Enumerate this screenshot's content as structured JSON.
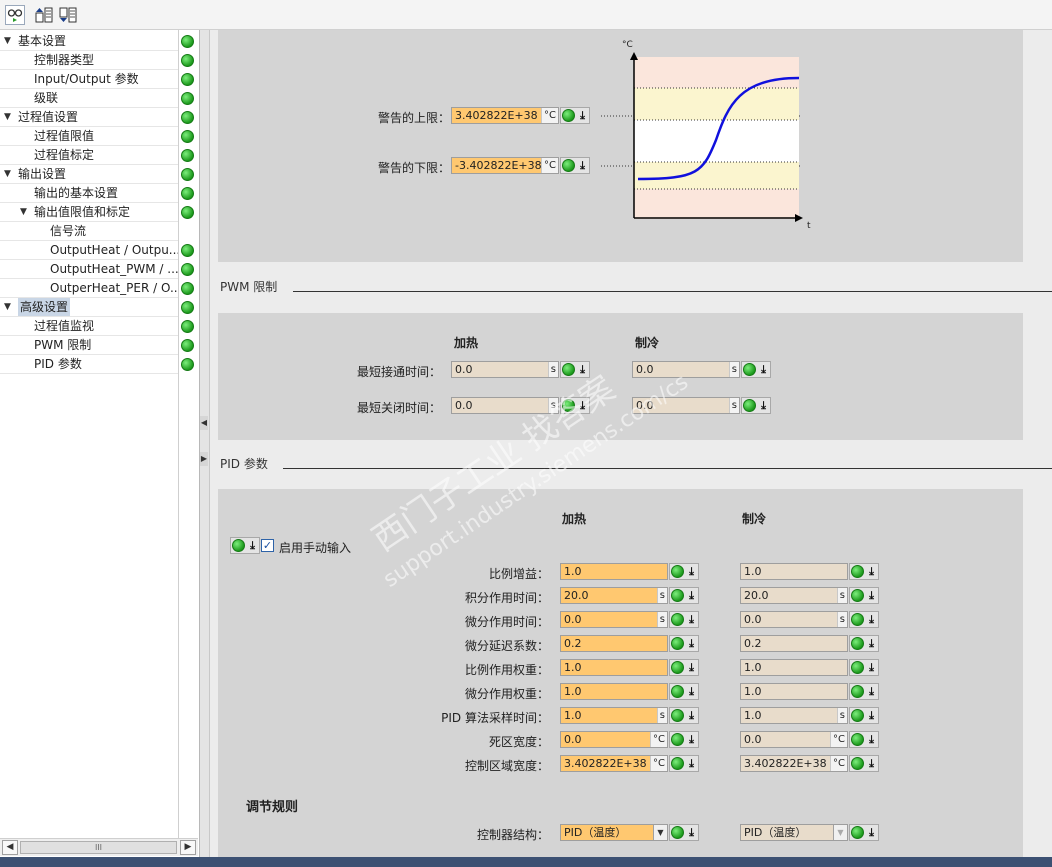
{
  "toolbar": {
    "icons": [
      "monitor-glasses-icon",
      "move-up-icon",
      "move-down-icon"
    ]
  },
  "nav": {
    "items": [
      {
        "label": "基本设置",
        "level": 0,
        "expanded": true
      },
      {
        "label": "控制器类型",
        "level": 1
      },
      {
        "label": "Input/Output 参数",
        "level": 1
      },
      {
        "label": "级联",
        "level": 1
      },
      {
        "label": "过程值设置",
        "level": 0,
        "expanded": true
      },
      {
        "label": "过程值限值",
        "level": 1
      },
      {
        "label": "过程值标定",
        "level": 1
      },
      {
        "label": "输出设置",
        "level": 0,
        "expanded": true
      },
      {
        "label": "输出的基本设置",
        "level": 1
      },
      {
        "label": "输出值限值和标定",
        "level": 1,
        "expanded": true
      },
      {
        "label": "信号流",
        "level": 2
      },
      {
        "label": "OutputHeat / Outpu...",
        "level": 2
      },
      {
        "label": "OutputHeat_PWM / ...",
        "level": 2
      },
      {
        "label": "OutperHeat_PER / O...",
        "level": 2
      },
      {
        "label": "高级设置",
        "level": 0,
        "expanded": true,
        "selected": true
      },
      {
        "label": "过程值监视",
        "level": 1
      },
      {
        "label": "PWM 限制",
        "level": 1
      },
      {
        "label": "PID 参数",
        "level": 1
      }
    ],
    "scroll_thumb": "III"
  },
  "warning": {
    "upper_label": "警告的上限：",
    "upper_value": "3.402822E+38",
    "upper_unit": "°C",
    "lower_label": "警告的下限：",
    "lower_value": "-3.402822E+38",
    "lower_unit": "°C",
    "chart_y_unit": "°C",
    "chart_x_unit": "t"
  },
  "pwm": {
    "title": "PWM 限制",
    "heat_header": "加热",
    "cool_header": "制冷",
    "rows": [
      {
        "label": "最短接通时间：",
        "heat": "0.0",
        "cool": "0.0",
        "unit": "s"
      },
      {
        "label": "最短关闭时间：",
        "heat": "0.0",
        "cool": "0.0",
        "unit": "s"
      }
    ]
  },
  "pid": {
    "title": "PID 参数",
    "heat_header": "加热",
    "cool_header": "制冷",
    "manual_entry_label": "启用手动输入",
    "manual_entry_checked": true,
    "rows": [
      {
        "label": "比例增益：",
        "heat": "1.0",
        "cool": "1.0",
        "unit": ""
      },
      {
        "label": "积分作用时间：",
        "heat": "20.0",
        "cool": "20.0",
        "unit": "s"
      },
      {
        "label": "微分作用时间：",
        "heat": "0.0",
        "cool": "0.0",
        "unit": "s"
      },
      {
        "label": "微分延迟系数：",
        "heat": "0.2",
        "cool": "0.2",
        "unit": ""
      },
      {
        "label": "比例作用权重：",
        "heat": "1.0",
        "cool": "1.0",
        "unit": ""
      },
      {
        "label": "微分作用权重：",
        "heat": "1.0",
        "cool": "1.0",
        "unit": ""
      },
      {
        "label": "PID 算法采样时间：",
        "heat": "1.0",
        "cool": "1.0",
        "unit": "s"
      },
      {
        "label": "死区宽度：",
        "heat": "0.0",
        "cool": "0.0",
        "unit": "°C"
      },
      {
        "label": "控制区域宽度：",
        "heat": "3.402822E+38",
        "cool": "3.402822E+38",
        "unit": "°C"
      }
    ],
    "rule_title": "调节规则",
    "structure_label": "控制器结构：",
    "structure_heat": "PID（温度）",
    "structure_cool": "PID（温度）"
  },
  "watermark": {
    "line1": "西门子工业 找答案",
    "line2": "support.industry.siemens.com/cs"
  },
  "colors": {
    "field_edit": "#ffc870",
    "field_readonly": "#e8dccb",
    "status_ok": "#22aa22",
    "selection": "#c9d6e6",
    "curve": "#1010dd"
  }
}
